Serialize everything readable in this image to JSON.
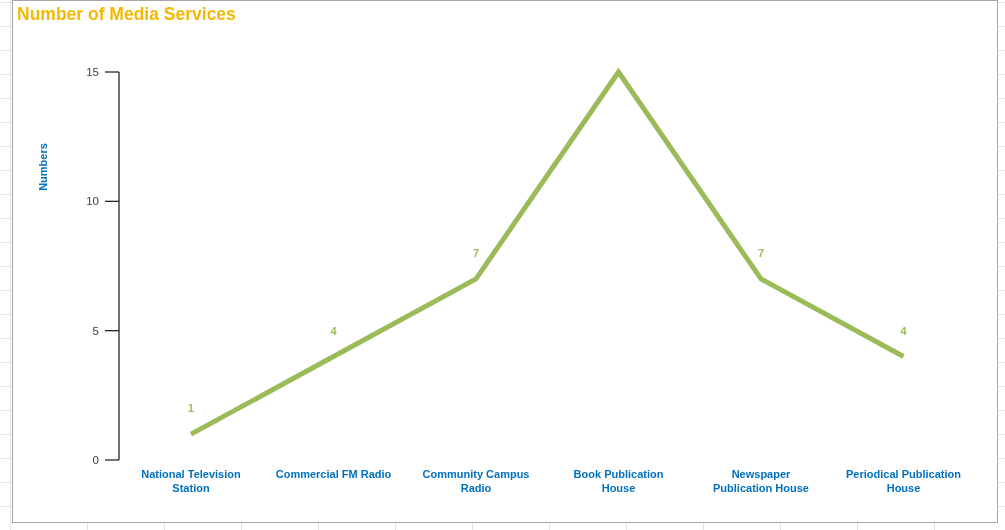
{
  "chart": {
    "title": "Number of Media Services",
    "chart_data": {
      "type": "line",
      "ylabel": "Numbers",
      "categories": [
        "National Television Station",
        "Commercial FM Radio",
        "Community Campus Radio",
        "Book Publication House",
        "Newspaper Publication House",
        "Periodical Publication House"
      ],
      "series": [
        {
          "color": "#9bbb59",
          "values": [
            1,
            4,
            7,
            15,
            7,
            4
          ]
        }
      ],
      "ylim": [
        0,
        15
      ],
      "yticks": [
        0,
        5,
        10,
        15
      ],
      "value_labels": [
        "1",
        "4",
        "7",
        null,
        "7",
        "4"
      ]
    }
  }
}
